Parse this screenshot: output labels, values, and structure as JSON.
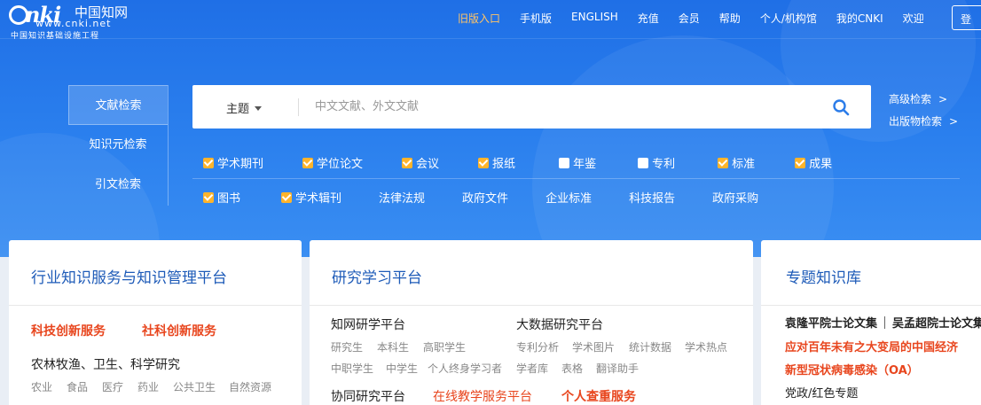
{
  "logo": {
    "mark": "nki",
    "chinese": "中国知网",
    "url": "www.cnki.net",
    "subtitle": "中国知识基础设施工程"
  },
  "nav": {
    "items": [
      "旧版入口",
      "手机版",
      "ENGLISH",
      "充值",
      "会员",
      "帮助",
      "个人/机构馆",
      "我的CNKI",
      "欢迎"
    ],
    "login": "登"
  },
  "search_tabs": [
    "文献检索",
    "知识元检索",
    "引文检索"
  ],
  "search": {
    "field": "主题",
    "placeholder": "中文文献、外文文献",
    "value": ""
  },
  "advanced": {
    "advanced_search": "高级检索",
    "publication_search": "出版物检索",
    "chevron": ">"
  },
  "databases": {
    "row1": [
      {
        "label": "学术期刊",
        "checked": true
      },
      {
        "label": "学位论文",
        "checked": true
      },
      {
        "label": "会议",
        "checked": true
      },
      {
        "label": "报纸",
        "checked": true
      },
      {
        "label": "年鉴",
        "checked": false
      },
      {
        "label": "专利",
        "checked": false
      },
      {
        "label": "标准",
        "checked": true
      },
      {
        "label": "成果",
        "checked": true
      }
    ],
    "row2_checked": [
      {
        "label": "图书",
        "checked": true
      },
      {
        "label": "学术辑刊",
        "checked": true
      }
    ],
    "row2_plain": [
      "法律法规",
      "政府文件",
      "企业标准",
      "科技报告",
      "政府采购"
    ]
  },
  "cards": {
    "industry": {
      "title": "行业知识服务与知识管理平台",
      "highlight": [
        "科技创新服务",
        "社科创新服务"
      ],
      "section": "农林牧渔、卫生、科学研究",
      "tags": [
        "农业",
        "食品",
        "医疗",
        "药业",
        "公共卫生",
        "自然资源"
      ]
    },
    "research": {
      "title": "研究学习平台",
      "col1_head": "知网研学平台",
      "col1_row1": [
        "研究生",
        "本科生",
        "高职学生"
      ],
      "col1_row2": [
        "中职学生",
        "中学生",
        "个人终身学习者"
      ],
      "col2_head": "大数据研究平台",
      "col2_row1": [
        "专利分析",
        "学术图片",
        "统计数据",
        "学术热点"
      ],
      "col2_row2": [
        "学者库",
        "表格",
        "翻译助手"
      ],
      "bottom": [
        "协同研究平台",
        "在线教学服务平台",
        "个人查重服务"
      ]
    },
    "topics": {
      "title": "专题知识库",
      "line1a": "袁隆平院士论文集",
      "line1b": "吴孟超院士论文集",
      "line2": "应对百年未有之大变局的中国经济",
      "line3": "新型冠状病毒感染（OA）",
      "line4": "党政/红色专题"
    }
  },
  "colors": {
    "primary_blue": "#2b80ee",
    "title_blue": "#1e5bb8",
    "accent_orange": "#ffb42b",
    "highlight_red": "#e8461e",
    "nav_active": "#ffc467"
  }
}
